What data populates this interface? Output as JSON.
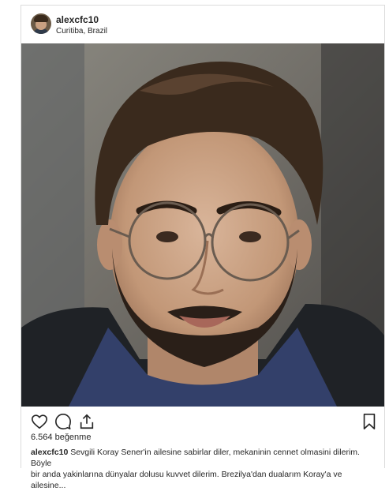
{
  "post": {
    "username": "alexcfc10",
    "location": "Curitiba, Brazil",
    "likes_text": "6.564 beğenme",
    "caption_user": "alexcfc10",
    "caption_line1": " Sevgili Koray Sener'in ailesine sabirlar diler, mekaninin cennet olmasini dilerim. Böyle",
    "caption_line2": "bir anda yakinlarına dünyalar dolusu kuvvet dilerim. Brezilya'dan dualarım Koray'a ve ailesine..."
  },
  "icons": {
    "like": "heart-icon",
    "comment": "comment-icon",
    "share": "share-icon",
    "save": "bookmark-icon"
  },
  "colors": {
    "text": "#262626",
    "border": "#dbdbdb"
  }
}
